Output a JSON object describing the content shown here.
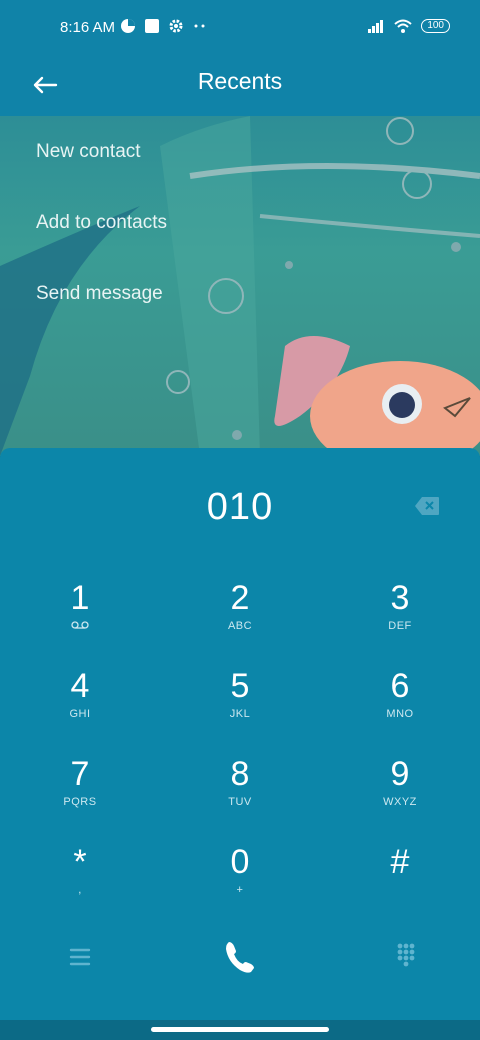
{
  "status_bar": {
    "time": "8:16 AM",
    "battery": "100",
    "icons_left": [
      "pie-icon",
      "square-icon",
      "gear-icon",
      "more-dots-icon"
    ],
    "icons_right": [
      "signal-icon",
      "wifi-icon",
      "battery-icon"
    ]
  },
  "header": {
    "title": "Recents",
    "back_icon": "arrow-left-icon"
  },
  "menu": {
    "items": [
      {
        "label": "New contact"
      },
      {
        "label": "Add to contacts"
      },
      {
        "label": "Send message"
      }
    ]
  },
  "dialer": {
    "number": "010",
    "keys": [
      {
        "digit": "1",
        "letters": "",
        "icon": "voicemail-icon"
      },
      {
        "digit": "2",
        "letters": "ABC"
      },
      {
        "digit": "3",
        "letters": "DEF"
      },
      {
        "digit": "4",
        "letters": "GHI"
      },
      {
        "digit": "5",
        "letters": "JKL"
      },
      {
        "digit": "6",
        "letters": "MNO"
      },
      {
        "digit": "7",
        "letters": "PQRS"
      },
      {
        "digit": "8",
        "letters": "TUV"
      },
      {
        "digit": "9",
        "letters": "WXYZ"
      },
      {
        "digit": "*",
        "letters": ","
      },
      {
        "digit": "0",
        "letters": "+"
      },
      {
        "digit": "#",
        "letters": ""
      }
    ],
    "actions": [
      "menu-icon",
      "call-icon",
      "dialpad-icon"
    ]
  },
  "colors": {
    "bar": "#1083a8",
    "dialer_bg": "#0c86a9",
    "wallpaper": "#3a9c95"
  }
}
